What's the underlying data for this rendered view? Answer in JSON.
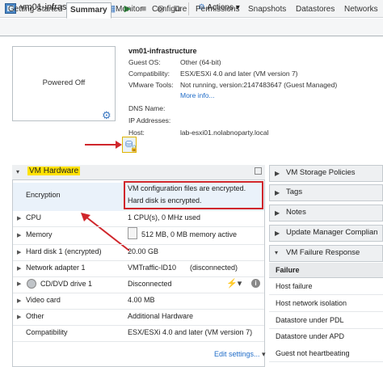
{
  "window": {
    "title": "vm01-infrastructure",
    "actions_label": "Actions"
  },
  "tabs": [
    "Getting Started",
    "Summary",
    "Monitor",
    "Configure",
    "Permissions",
    "Snapshots",
    "Datastores",
    "Networks"
  ],
  "active_tab": "Summary",
  "console": {
    "state": "Powered Off"
  },
  "summary": {
    "name": "vm01-infrastructure",
    "rows": [
      {
        "label": "Guest OS:",
        "value": "Other (64-bit)"
      },
      {
        "label": "Compatibility:",
        "value": "ESX/ESXi 4.0 and later (VM version 7)"
      },
      {
        "label": "VMware Tools:",
        "value": "Not running, version:2147483647 (Guest Managed)"
      },
      {
        "label": "",
        "value": "More info..."
      },
      {
        "label": "DNS Name:",
        "value": ""
      },
      {
        "label": "IP Addresses:",
        "value": ""
      },
      {
        "label": "Host:",
        "value": "lab-esxi01.nolabnoparty.local"
      }
    ]
  },
  "hardware": {
    "title": "VM Hardware",
    "encryption": {
      "label": "Encryption",
      "line1": "VM configuration files are encrypted.",
      "line2": "Hard disk is encrypted."
    },
    "rows": [
      {
        "label": "CPU",
        "value": "1 CPU(s), 0 MHz used"
      },
      {
        "label": "Memory",
        "value": "512 MB, 0 MB memory active"
      },
      {
        "label": "Hard disk 1 (encrypted)",
        "value": "20.00 GB"
      },
      {
        "label": "Network adapter 1",
        "value_link": "VMTraffic-ID10",
        "value": "(disconnected)"
      },
      {
        "label": "CD/DVD drive 1",
        "value": "Disconnected"
      },
      {
        "label": "Video card",
        "value": "4.00 MB"
      },
      {
        "label": "Other",
        "value": "Additional Hardware"
      },
      {
        "label": "Compatibility",
        "value": "ESX/ESXi 4.0 and later (VM version 7)"
      }
    ],
    "edit_label": "Edit settings..."
  },
  "right_panels": [
    "VM Storage Policies",
    "Tags",
    "Notes",
    "Update Manager Complian"
  ],
  "failure": {
    "title": "VM Failure Response",
    "header": "Failure",
    "items": [
      "Host failure",
      "Host network isolation",
      "Datastore under PDL",
      "Datastore under APD",
      "Guest not heartbeating"
    ]
  },
  "colors": {
    "highlight": "#ffe200",
    "annotation_red": "#d0262b",
    "link": "#1f6cc8"
  }
}
